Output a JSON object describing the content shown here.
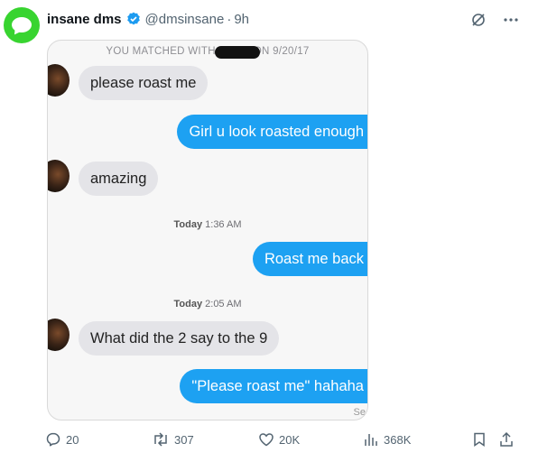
{
  "author": {
    "name": "insane dms",
    "handle": "@dmsinsane",
    "separator": "·",
    "time": "9h"
  },
  "media": {
    "matched_prefix": "YOU MATCHED WITH",
    "matched_suffix": "ON 9/20/17",
    "messages": [
      {
        "text": "please roast me"
      },
      {
        "text": "Girl u look roasted enough"
      },
      {
        "text": "amazing"
      },
      {
        "text": "Roast me back"
      },
      {
        "text": "What did the 2 say to the 9"
      },
      {
        "text": "\"Please roast me\" hahaha"
      }
    ],
    "timestamps": [
      {
        "day": "Today",
        "time": "1:36 AM"
      },
      {
        "day": "Today",
        "time": "2:05 AM"
      }
    ],
    "cutoff_text": "Se"
  },
  "actions": {
    "replies": "20",
    "reposts": "307",
    "likes": "20K",
    "views": "368K"
  },
  "colors": {
    "accent": "#1da1f2",
    "avatar": "#38d430",
    "incoming_bubble": "#e4e4e8",
    "verified": "#1d9bf0"
  }
}
